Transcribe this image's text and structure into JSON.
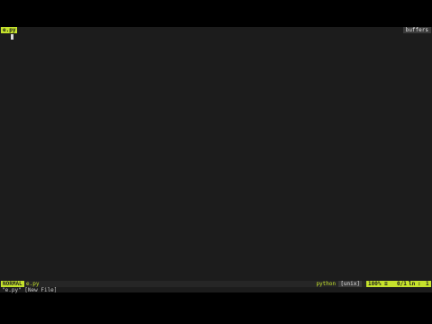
{
  "tabline": {
    "active_tab": "e.py",
    "buffers_label": "buffers"
  },
  "statusline": {
    "mode": "NORMAL",
    "filename": "e.py",
    "filetype": "python",
    "fileformat": "[unix]",
    "percent": "100%",
    "percent_symbol": "≡",
    "line_info": "0/1",
    "ln_symbol": "ln",
    "col_sep": ":",
    "col": "1"
  },
  "cmdline": {
    "message": "\"e.py\" [New File]"
  },
  "colors": {
    "accent": "#c5e22c",
    "background": "#1c1c1c",
    "letterbox": "#000000"
  }
}
